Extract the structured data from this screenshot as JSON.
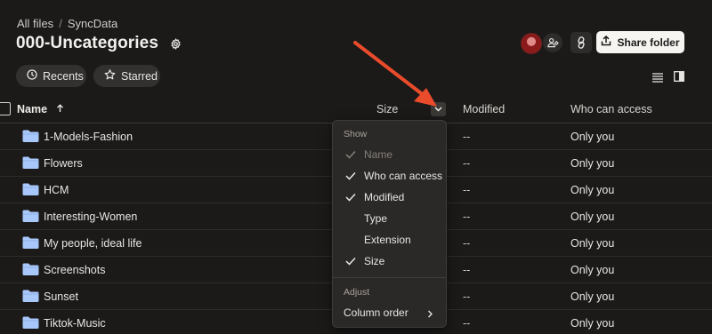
{
  "breadcrumb": {
    "root": "All files",
    "separator": "/",
    "current": "SyncData"
  },
  "page": {
    "title": "000-Uncategories"
  },
  "header_actions": {
    "share_folder_label": "Share folder"
  },
  "filters": {
    "recents": "Recents",
    "starred": "Starred"
  },
  "table": {
    "columns": {
      "name": "Name",
      "size": "Size",
      "modified": "Modified",
      "access": "Who can access"
    },
    "sort": {
      "column": "Name",
      "direction": "ascending"
    },
    "rows": [
      {
        "name": "1-Models-Fashion",
        "modified": "--",
        "access": "Only you"
      },
      {
        "name": "Flowers",
        "modified": "--",
        "access": "Only you"
      },
      {
        "name": "HCM",
        "modified": "--",
        "access": "Only you"
      },
      {
        "name": "Interesting-Women",
        "modified": "--",
        "access": "Only you"
      },
      {
        "name": "My people, ideal life",
        "modified": "--",
        "access": "Only you"
      },
      {
        "name": "Screenshots",
        "modified": "--",
        "access": "Only you"
      },
      {
        "name": "Sunset",
        "modified": "--",
        "access": "Only you"
      },
      {
        "name": "Tiktok-Music",
        "modified": "--",
        "access": "Only you"
      }
    ]
  },
  "column_menu": {
    "show_label": "Show",
    "items": [
      {
        "label": "Name",
        "checked": true,
        "disabled": true
      },
      {
        "label": "Who can access",
        "checked": true,
        "disabled": false
      },
      {
        "label": "Modified",
        "checked": true,
        "disabled": false
      },
      {
        "label": "Type",
        "checked": false,
        "disabled": false
      },
      {
        "label": "Extension",
        "checked": false,
        "disabled": false
      },
      {
        "label": "Size",
        "checked": true,
        "disabled": false
      }
    ],
    "adjust_label": "Adjust",
    "column_order_label": "Column order"
  },
  "colors": {
    "background": "#1b1a19",
    "folder": "#a8c7fa",
    "annotation_arrow": "#ea4b2a",
    "menu_background": "#2b2927"
  },
  "icons": {
    "settings": "gear-icon",
    "share_access": "people-icon",
    "copy_link": "link-icon",
    "share_folder": "share-icon",
    "recents": "clock-icon",
    "starred": "star-icon",
    "list_view": "list-view-icon",
    "details_panel": "panel-icon",
    "sort": "arrow-up-icon",
    "size_menu": "chevron-down-icon",
    "folder": "folder-icon",
    "check": "check-icon",
    "submenu": "chevron-right-icon"
  }
}
